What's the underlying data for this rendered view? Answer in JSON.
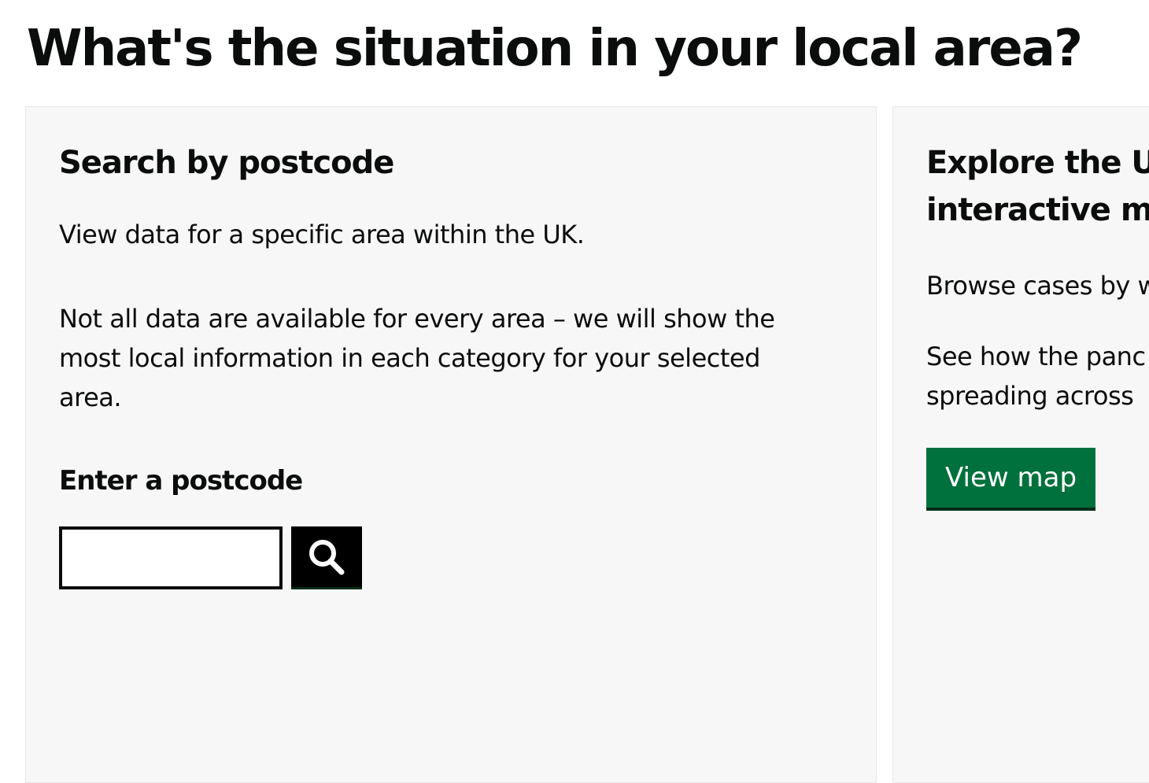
{
  "page": {
    "title": "What's the situation in your local area?"
  },
  "postcode_card": {
    "heading": "Search by postcode",
    "intro": "View data for a specific area within the UK.",
    "note": "Not all data are available for every area – we will show the most local information in each category for your selected area.",
    "input_label": "Enter a postcode",
    "input_value": "",
    "search_icon": "search-icon"
  },
  "map_card": {
    "heading_line1": "Explore the U",
    "heading_line2": "interactive m",
    "text1": "Browse cases by w",
    "text2_line1": "See how the panc",
    "text2_line2": "spreading across",
    "button_label": "View map"
  },
  "colors": {
    "text": "#0b0c0c",
    "card_background": "#f7f7f7",
    "button_green": "#00703c",
    "search_button": "#000000"
  }
}
